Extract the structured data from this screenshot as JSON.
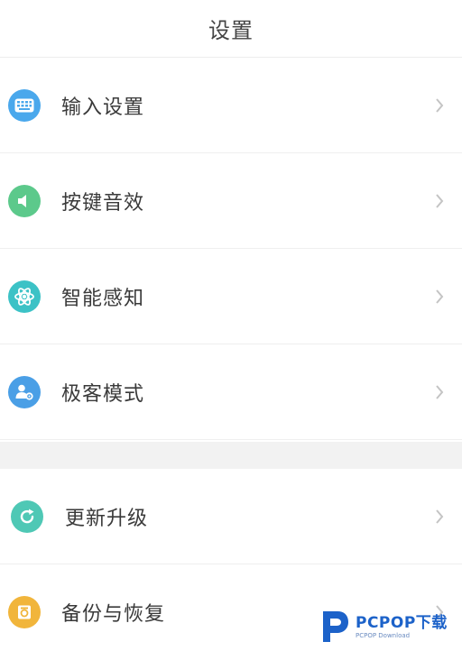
{
  "header": {
    "title": "设置"
  },
  "menu": [
    {
      "label": "输入设置",
      "icon": "keyboard-icon",
      "color": "#4aa8ec"
    },
    {
      "label": "按键音效",
      "icon": "speaker-icon",
      "color": "#5cc98b"
    },
    {
      "label": "智能感知",
      "icon": "atom-icon",
      "color": "#3cc2c6"
    },
    {
      "label": "极客模式",
      "icon": "geek-user-icon",
      "color": "#4a9fe6"
    },
    {
      "label": "更新升级",
      "icon": "refresh-icon",
      "color": "#4fc8b5"
    },
    {
      "label": "备份与恢复",
      "icon": "backup-icon",
      "color": "#f1b53b"
    }
  ],
  "watermark": {
    "main": "PCPOP下载",
    "sub": "PCPOP Download",
    "color": "#1c62c9"
  }
}
